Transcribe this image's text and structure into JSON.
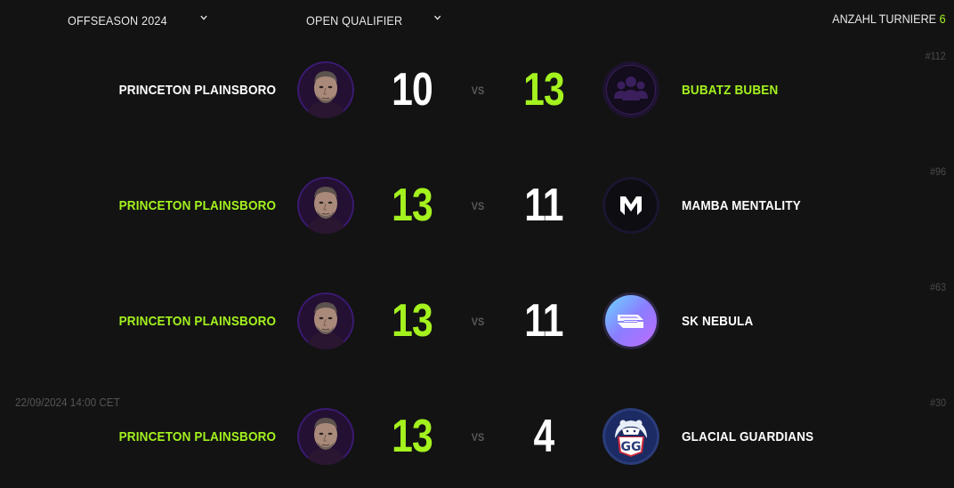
{
  "filters": {
    "season": "OFFSEASON 2024",
    "stage": "OPEN QUALIFIER"
  },
  "tournament_count": {
    "label": "ANZAHL TURNIERE",
    "value": "6"
  },
  "colors": {
    "background": "#131313",
    "accent": "#a4f21e",
    "muted": "#4a4a4a"
  },
  "matches": [
    {
      "id": "#112",
      "date": "",
      "vs": "VS",
      "left": {
        "name": "PRINCETON PLAINSBORO",
        "score": "10",
        "winner": false,
        "logo": "house-portrait-avatar"
      },
      "right": {
        "name": "BUBATZ BUBEN",
        "score": "13",
        "winner": true,
        "logo": "people-group-icon"
      }
    },
    {
      "id": "#96",
      "date": "",
      "vs": "VS",
      "left": {
        "name": "PRINCETON PLAINSBORO",
        "score": "13",
        "winner": true,
        "logo": "house-portrait-avatar"
      },
      "right": {
        "name": "MAMBA MENTALITY",
        "score": "11",
        "winner": false,
        "logo": "mamba-m-logo"
      }
    },
    {
      "id": "#63",
      "date": "",
      "vs": "VS",
      "left": {
        "name": "PRINCETON PLAINSBORO",
        "score": "13",
        "winner": true,
        "logo": "house-portrait-avatar"
      },
      "right": {
        "name": "SK NEBULA",
        "score": "11",
        "winner": false,
        "logo": "sk-nebula-logo"
      }
    },
    {
      "id": "#30",
      "date": "22/09/2024 14:00 CET",
      "vs": "VS",
      "left": {
        "name": "PRINCETON PLAINSBORO",
        "score": "13",
        "winner": true,
        "logo": "house-portrait-avatar"
      },
      "right": {
        "name": "GLACIAL GUARDIANS",
        "score": "4",
        "winner": false,
        "logo": "polar-bear-gg-logo"
      }
    }
  ]
}
